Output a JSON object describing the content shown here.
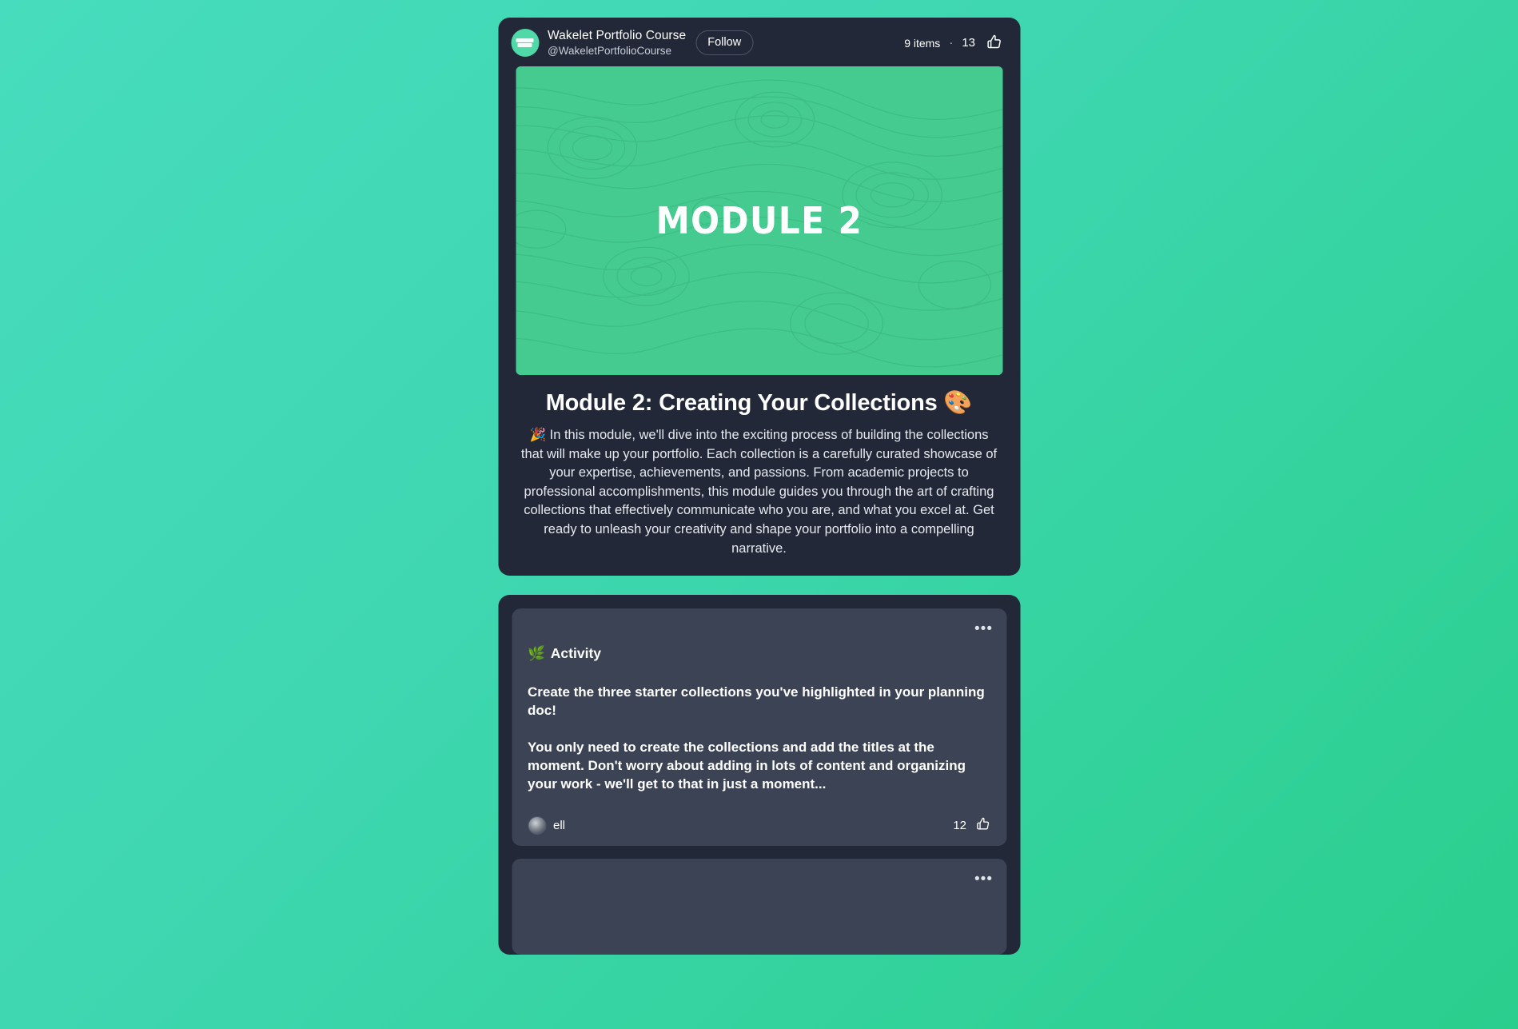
{
  "background": {
    "gradient_from": "#46dcbd",
    "gradient_to": "#2bce8d"
  },
  "collection": {
    "account": {
      "name": "Wakelet Portfolio Course",
      "handle": "@WakeletPortfolioCourse",
      "avatar_icon": "portfolio-course-logo"
    },
    "follow_label": "Follow",
    "stats": {
      "items": "9 items",
      "separator": "·",
      "likes": "13",
      "like_icon": "thumbs-up-icon"
    },
    "banner": {
      "text": "MODULE 2",
      "background_color": "#45ca8f",
      "pattern": "topographic-contour-lines"
    },
    "title": "Module 2: Creating Your Collections 🎨",
    "description": "🎉 In this module, we'll dive into the exciting process of building the collections that will make up your portfolio. Each collection is a carefully curated showcase of your expertise, achievements, and passions. From academic projects to professional accomplishments, this module guides you through the art of crafting collections that effectively communicate who you are, and what you excel at. Get ready to unleash your creativity and shape your portfolio into a compelling narrative."
  },
  "items": [
    {
      "more_label": "•••",
      "label_emoji": "🌿",
      "label": "Activity",
      "paragraphs": [
        "Create the three starter collections you've highlighted in your planning doc!",
        "You only need to create the collections and add the titles at the moment. Don't worry about adding in lots of content and organizing your work - we'll get to that in just a moment..."
      ],
      "author": "ell",
      "likes": "12",
      "like_icon": "thumbs-up-icon"
    },
    {
      "more_label": "•••"
    }
  ]
}
